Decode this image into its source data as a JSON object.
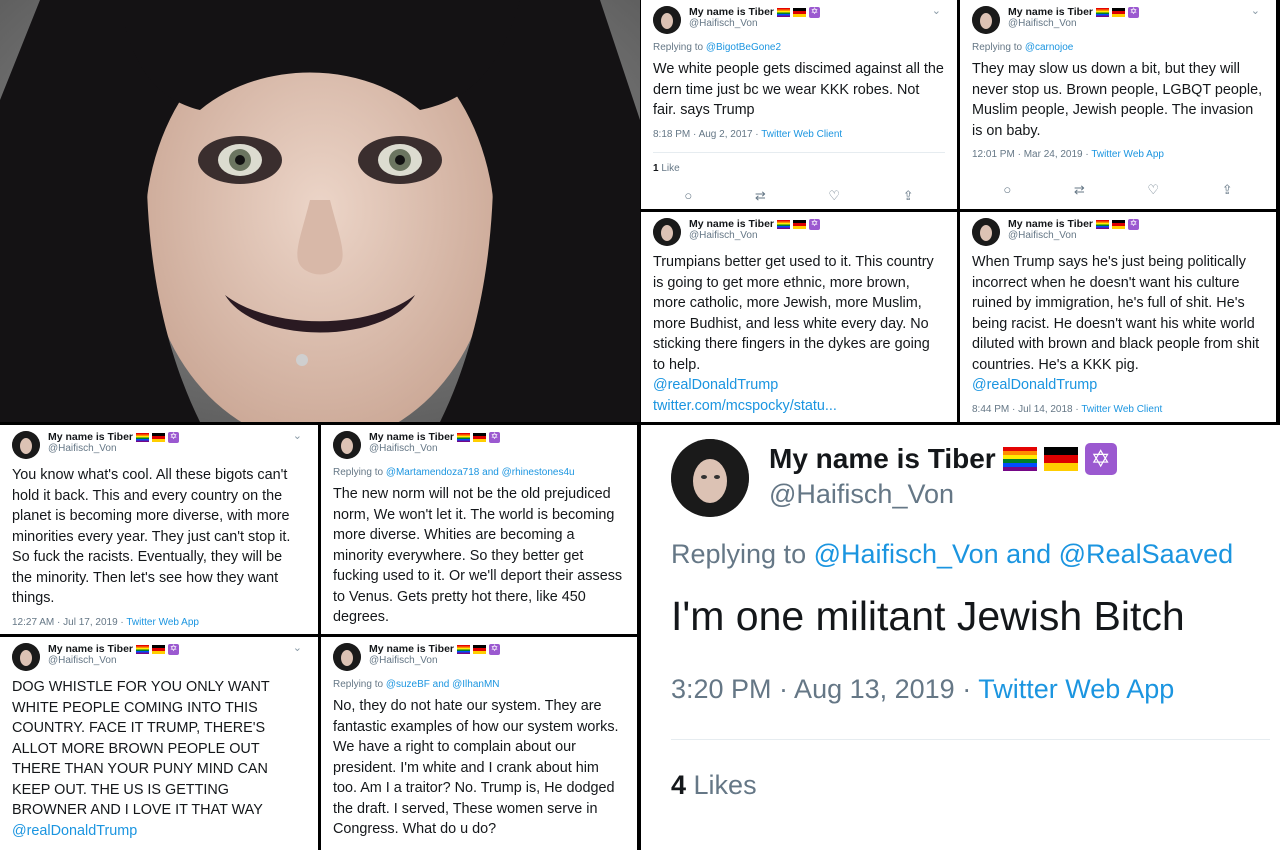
{
  "author": {
    "display_name": "My name is Tiber",
    "handle": "@Haifisch_Von",
    "flags": [
      "rainbow-flag-icon",
      "german-flag-icon",
      "star-of-david-icon"
    ]
  },
  "tweets": [
    {
      "replying_prefix": "Replying to ",
      "replying_to": "@BigotBeGone2",
      "text": "We white people gets discimed against all the dern time just bc we wear KKK robes. Not fair. says Trump",
      "time": "8:18 PM · Aug 2, 2017 · ",
      "client": "Twitter Web Client",
      "likes_count": "1",
      "likes_label": " Like"
    },
    {
      "replying_prefix": "Replying to ",
      "replying_to": "@carnojoe",
      "text": "They may slow us down a bit, but they will never stop us. Brown people, LGBQT people, Muslim people, Jewish people. The invasion is on baby.",
      "time": "12:01 PM · Mar 24, 2019 · ",
      "client": "Twitter Web App"
    },
    {
      "text": "Trumpians better get used to it.  This country is going to get more ethnic, more brown, more catholic, more Jewish, more Muslim, more Budhist, and less white every day. No sticking there fingers in the dykes are going to help.",
      "link1": "@realDonaldTrump",
      "link2": "twitter.com/mcspocky/statu..."
    },
    {
      "text": "When Trump says he's just being politically incorrect when he doesn't want his culture ruined by immigration, he's full of shit. He's being racist. He doesn't want his white world diluted with brown and black people from shit countries. He's a KKK pig.",
      "link1": "@realDonaldTrump",
      "time": "8:44 PM · Jul 14, 2018 · ",
      "client": "Twitter Web Client"
    },
    {
      "text": "You know what's cool. All these bigots can't hold it back. This and every country on the planet is becoming more diverse, with more minorities every year. They just can't stop it. So fuck the racists. Eventually, they will be the minority. Then let's see how they want things.",
      "time": "12:27 AM · Jul 17, 2019 · ",
      "client": "Twitter Web App"
    },
    {
      "replying_prefix": "Replying to ",
      "replying_to": "@Martamendoza718 and @rhinestones4u",
      "text": "The new norm will not be the old prejudiced norm, We won't let it. The world is becoming more diverse. Whities are becoming a minority everywhere. So they better get fucking used to it. Or we'll deport their assess to Venus. Gets pretty hot there, like 450 degrees."
    },
    {
      "text": "DOG WHISTLE FOR YOU ONLY WANT WHITE PEOPLE COMING INTO THIS COUNTRY. FACE IT TRUMP, THERE'S ALLOT MORE BROWN PEOPLE OUT THERE THAN YOUR PUNY MIND CAN KEEP OUT. THE US IS GETTING BROWNER AND I LOVE IT THAT WAY",
      "link1": "@realDonaldTrump"
    },
    {
      "replying_prefix": "Replying to ",
      "replying_to": "@suzeBF and @IlhanMN",
      "text": "No, they do not hate our system. They are fantastic examples of how our system works. We have a right to complain about our president. I'm white and I crank about him too. Am I a traitor? No. Trump is, He dodged the draft. I served, These women serve in Congress. What do u do?"
    },
    {
      "replying_prefix": "Replying to ",
      "replying_to": "@Haifisch_Von and @RealSaaved",
      "text": "I'm one militant Jewish Bitch",
      "time": "3:20 PM · Aug 13, 2019 · ",
      "client": "Twitter Web App",
      "likes_count": "4",
      "likes_label": " Likes"
    }
  ],
  "colors": {
    "link": "#1b95e0",
    "muted": "#657786",
    "text": "#14171a"
  }
}
